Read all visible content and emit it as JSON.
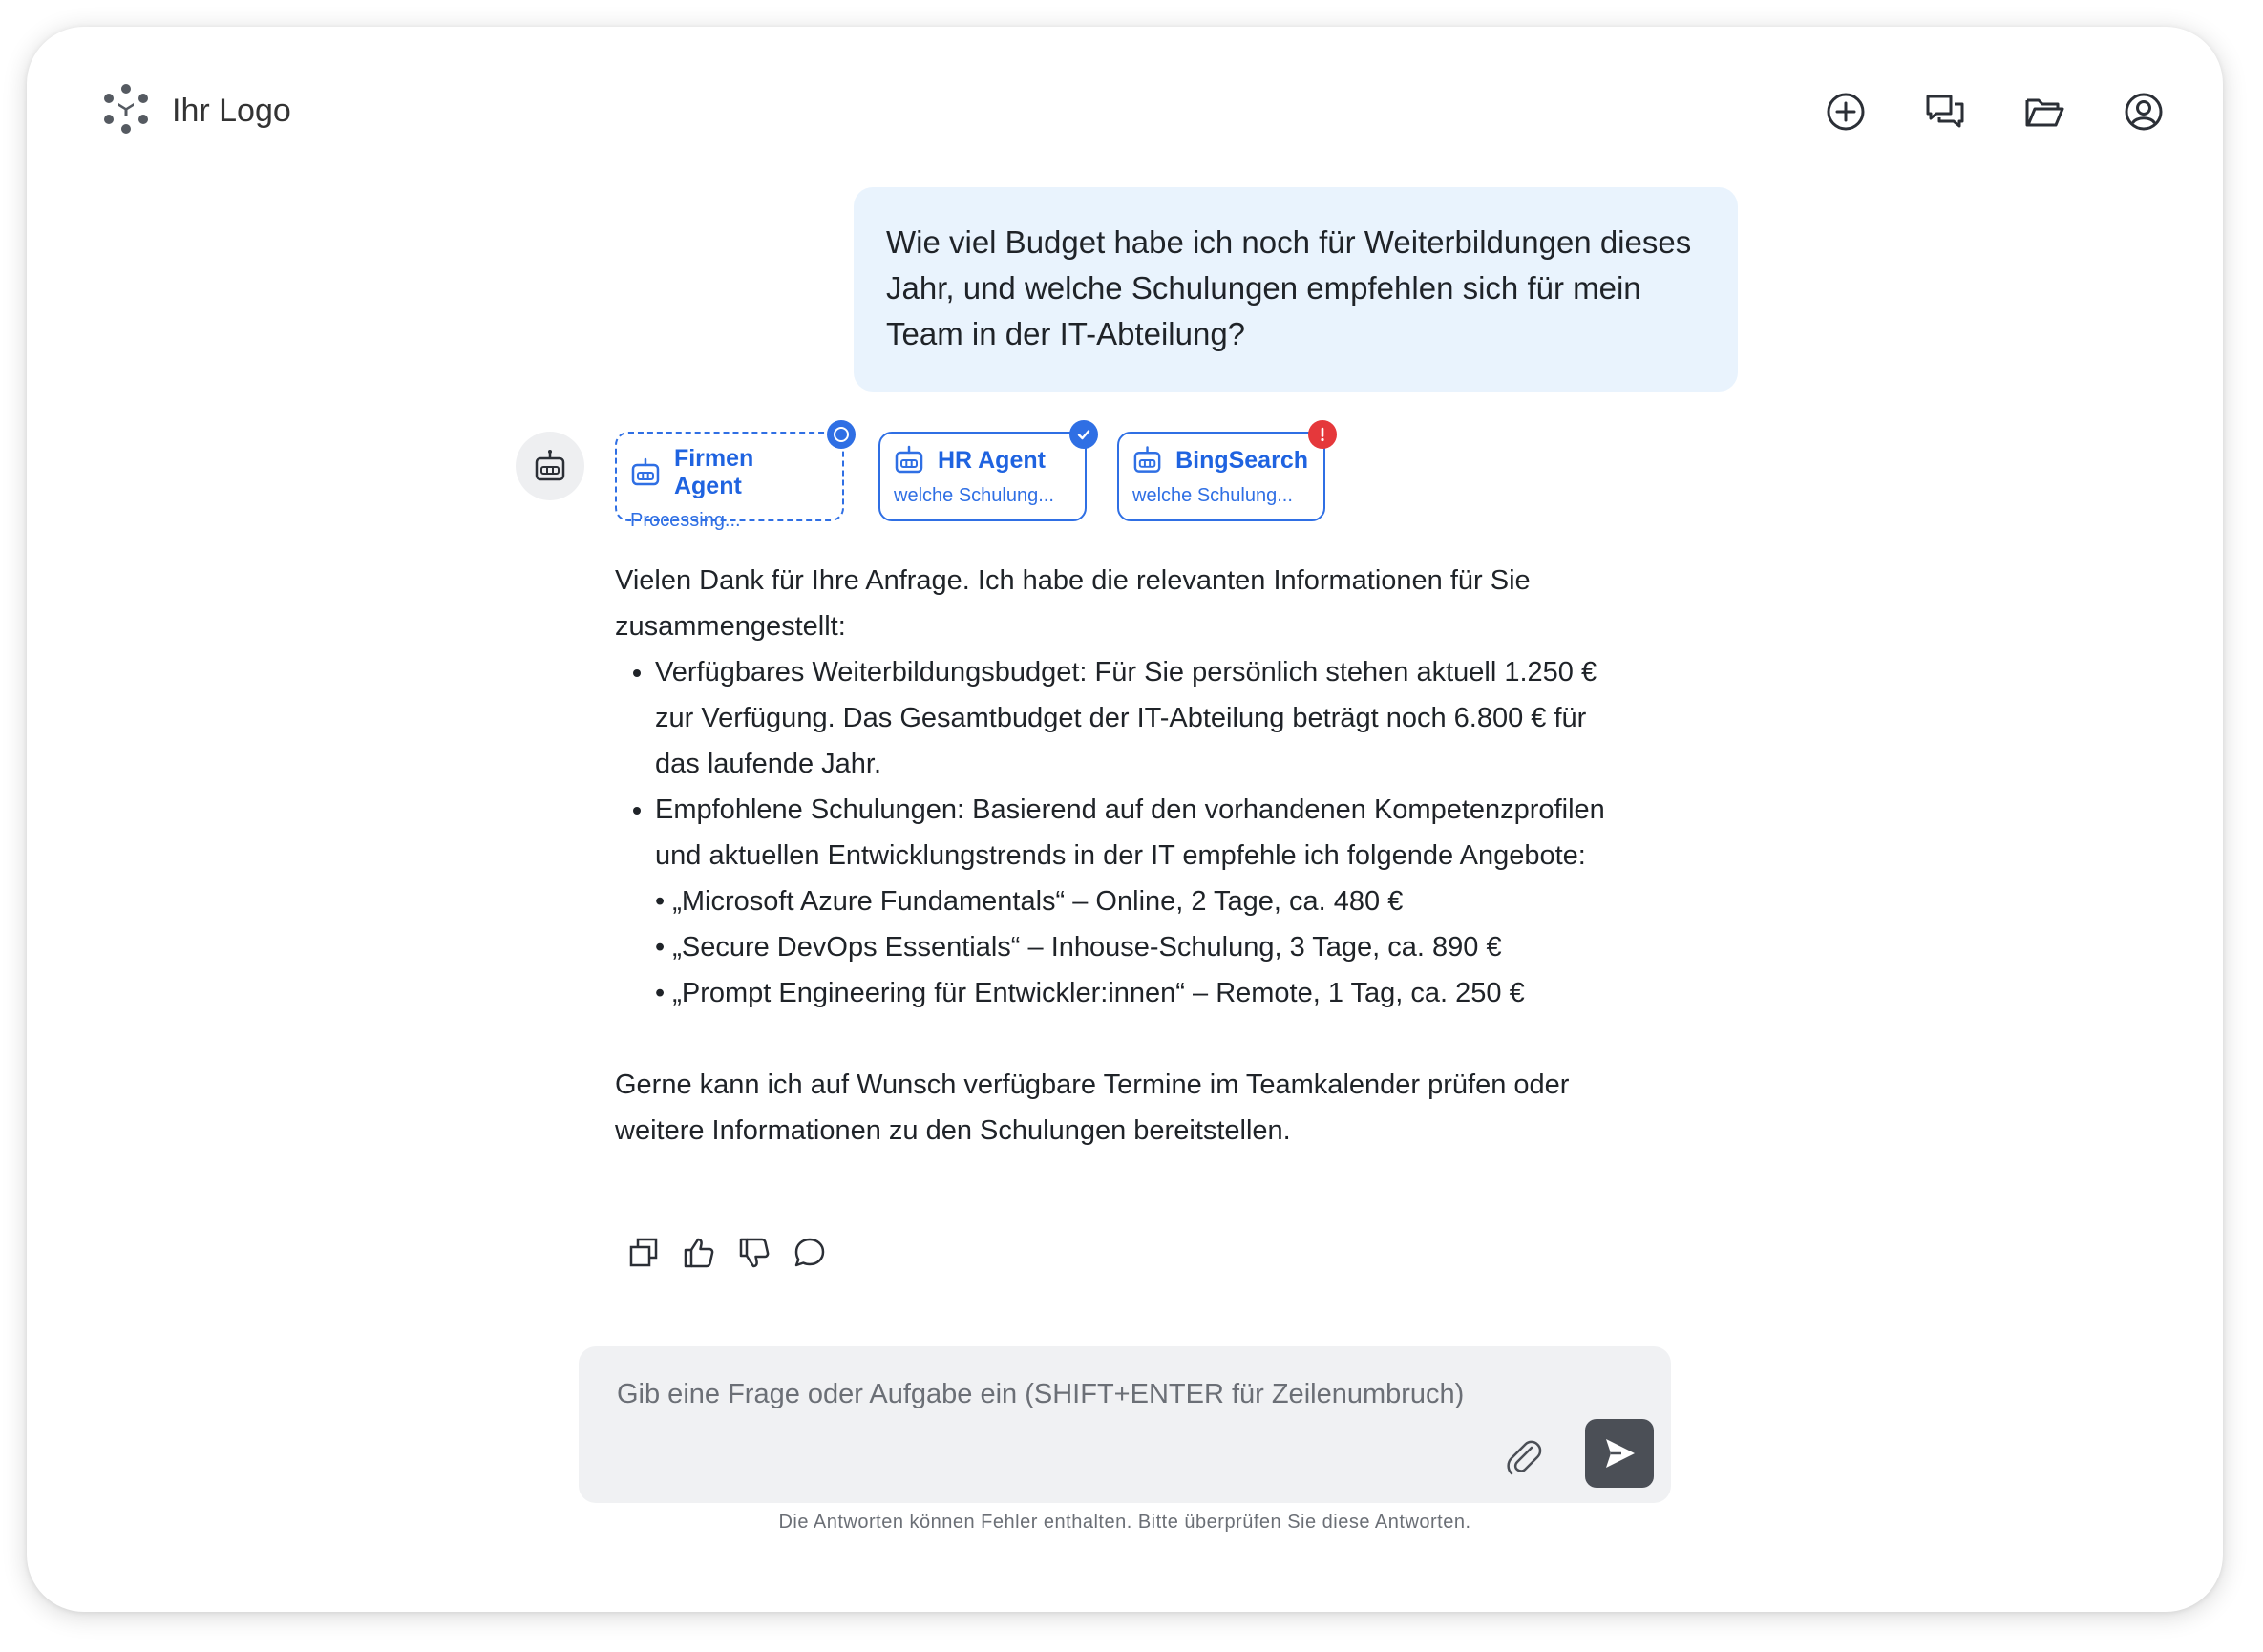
{
  "header": {
    "logo_text": "Ihr Logo",
    "nav": [
      {
        "name": "new-chat-icon"
      },
      {
        "name": "chat-history-icon"
      },
      {
        "name": "folder-icon"
      },
      {
        "name": "account-icon"
      }
    ]
  },
  "user_message": "Wie viel Budget habe ich noch für Weiterbildungen dieses Jahr, und welche Schulungen empfehlen sich für mein Team in der IT-Abteilung?",
  "agents": [
    {
      "name": "Firmen Agent",
      "sub": "Processing...",
      "status": "processing"
    },
    {
      "name": "HR Agent",
      "sub": "welche Schulung...",
      "status": "done"
    },
    {
      "name": "BingSearch",
      "sub": "welche Schulung...",
      "status": "error"
    }
  ],
  "answer": {
    "intro": "Vielen Dank für Ihre Anfrage. Ich habe die relevanten Informationen für Sie zusammengestellt:",
    "bullet1": "Verfügbares Weiterbildungsbudget: Für Sie persönlich stehen aktuell 1.250 € zur Verfügung. Das Gesamtbudget der IT-Abteilung beträgt noch 6.800 € für das laufende Jahr.",
    "bullet2": "Empfohlene Schulungen: Basierend auf den vorhandenen Kompetenzprofilen und aktuellen Entwicklungstrends in der IT empfehle ich folgende Angebote:",
    "sub_items": [
      "• „Microsoft Azure Fundamentals“ – Online, 2 Tage, ca. 480 €",
      "• „Secure DevOps Essentials“ – Inhouse-Schulung, 3 Tage, ca. 890 €",
      "• „Prompt Engineering für Entwickler:innen“ – Remote, 1 Tag, ca. 250 €"
    ],
    "closing": "Gerne kann ich auf Wunsch verfügbare Termine im Teamkalender prüfen oder weitere Informationen zu den Schulungen bereitstellen."
  },
  "composer": {
    "placeholder": "Gib eine Frage oder Aufgabe ein (SHIFT+ENTER für Zeilenumbruch)"
  },
  "disclaimer": "Die Antworten können Fehler enthalten. Bitte überprüfen Sie diese Antworten.",
  "colors": {
    "accent": "#2f6fe4",
    "user_bubble": "#e9f3fd",
    "status_done": "#2f6fe4",
    "status_error": "#e5383b",
    "send_button": "#4b4f56"
  }
}
